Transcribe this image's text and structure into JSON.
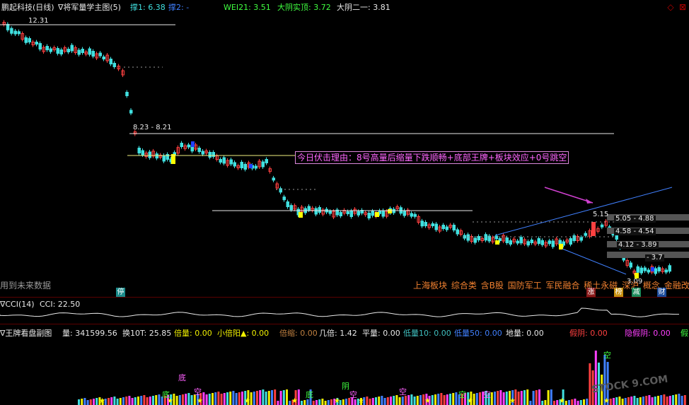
{
  "header": {
    "stock": "鹏起科技(日线)",
    "indicator": "∇将军量学主图(5)",
    "support1": "撑1: 6.38",
    "support2": "撑2: -",
    "wei21": "WEI21: 3.51",
    "big_yin_top": "大阴实顶: 3.72",
    "big_yin_second": "大阴二一: 3.81"
  },
  "window_controls": {
    "restore": "◇",
    "close": "⊠"
  },
  "main": {
    "price_high": "12.31",
    "level_823": "8.23 - 8.21",
    "callout": "今日伏击理由：8号高量后缩量下跌顺畅+底部王牌+板块效应+0号跳空",
    "level_515": "5.15",
    "box1": "5.05 - 4.88",
    "box2": "4.58 - 4.54",
    "box3": "4.12 - 3.89",
    "box4_partial": "- 3.7",
    "low_price": "3.09",
    "future_note": "用到未来数据",
    "sectors": "上海板块 综合类 含B股 国防军工 军民融合 稀土永磁 深沪 概念 金融改革",
    "badges": [
      {
        "text": "停",
        "color": "#1a8a8a"
      },
      {
        "text": "涨",
        "color": "#8a1a1a"
      },
      {
        "text": "榜",
        "color": "#c89010"
      },
      {
        "text": "减",
        "color": "#1a8a5a"
      },
      {
        "text": "财",
        "color": "#1a4a9a"
      }
    ]
  },
  "cci": {
    "name": "∇CCI(14)",
    "value": "CCI: 22.50"
  },
  "volume_panel": {
    "name": "∇王牌看盘副图",
    "items": [
      {
        "text": "量: 341599.56",
        "color": "#e8e8e8"
      },
      {
        "text": "换10T: 25.85",
        "color": "#e8e8e8"
      },
      {
        "text": "倍量: 0.00",
        "color": "#f0f000"
      },
      {
        "text": "小倍阳▲: 0.00",
        "color": "#f0f000"
      },
      {
        "text": "倍缩: 0.00",
        "color": "#c08040"
      },
      {
        "text": "几倍: 1.42",
        "color": "#e8e8e8"
      },
      {
        "text": "平量: 0.00",
        "color": "#e8e8e8"
      },
      {
        "text": "低量10: 0.00",
        "color": "#40c0c0"
      },
      {
        "text": "低量50: 0.00",
        "color": "#4080ff"
      },
      {
        "text": "地量: 0.00",
        "color": "#e8e8e8"
      },
      {
        "text": "假阴: 0.00",
        "color": "#ff4040"
      },
      {
        "text": "隐假阴: 0.00",
        "color": "#ff40ff"
      },
      {
        "text": "假",
        "color": "#40ff40"
      }
    ],
    "markers": [
      "底",
      "底",
      "空",
      "底",
      "空",
      "阴",
      "空",
      "空",
      "空",
      "空"
    ],
    "watermark": "STOCK 9.COM"
  },
  "colors": {
    "up": "#ff4040",
    "down": "#40e0e0",
    "star": "#ffff00",
    "blue_candle": "#2040ff",
    "trend": "#4080ff",
    "arrow": "#d040d0"
  }
}
